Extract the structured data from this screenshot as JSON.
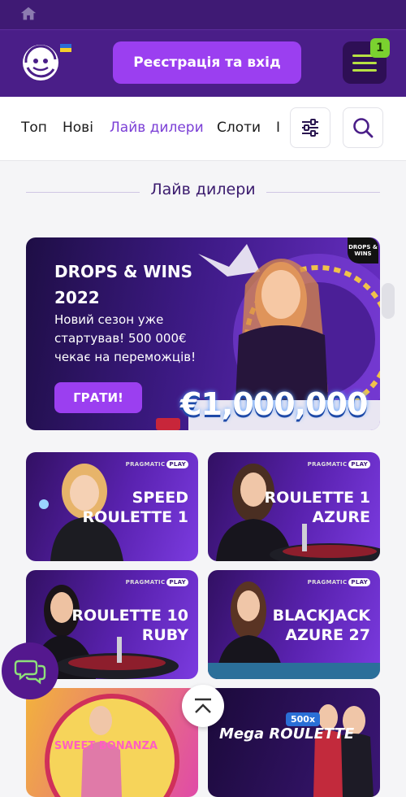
{
  "header": {
    "register_label": "Реєстрація та вхід",
    "menu_badge": "1"
  },
  "nav": {
    "tabs": [
      {
        "label": "Топ"
      },
      {
        "label": "Нові"
      },
      {
        "label": "Лайв дилери"
      },
      {
        "label": "Слоти"
      },
      {
        "label": "І"
      }
    ]
  },
  "section": {
    "title": "Лайв дилери"
  },
  "banner": {
    "title": "DROPS & WINS 2022",
    "description": "Новий сезон уже стартував! 500 000€ чекає на переможців!",
    "button_label": "ГРАТИ!",
    "badge": "DROPS & WINS",
    "amount": "€1,000,000"
  },
  "games": [
    {
      "provider": "PRAGMATIC",
      "provider_tag": "PLAY",
      "title": "SPEED\nROULETTE 1"
    },
    {
      "provider": "PRAGMATIC",
      "provider_tag": "PLAY",
      "title": "ROULETTE 1\nAZURE"
    },
    {
      "provider": "PRAGMATIC",
      "provider_tag": "PLAY",
      "title": "ROULETTE 10\nRUBY"
    },
    {
      "provider": "PRAGMATIC",
      "provider_tag": "PLAY",
      "title": "BLACKJACK\nAZURE 27"
    }
  ],
  "bottom_cards": [
    {
      "title": "SWEET BONANZA"
    },
    {
      "title": "Mega ROULETTE",
      "multiplier": "500x"
    }
  ],
  "colors": {
    "header_bg": "#4a1e88",
    "accent": "#9b3ff0",
    "active_tab": "#7b3fd6",
    "badge": "#7ad12f"
  }
}
